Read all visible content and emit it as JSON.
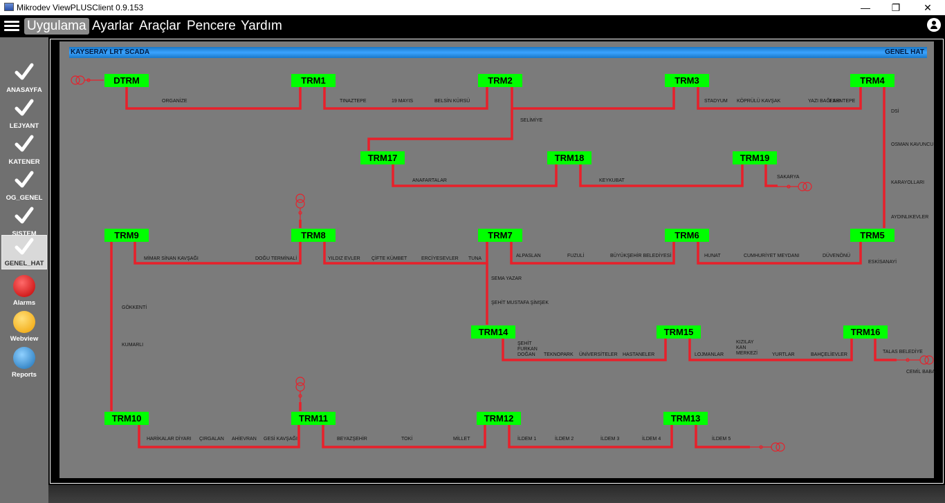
{
  "window": {
    "title": "Mikrodev ViewPLUSClient 0.9.153",
    "minimize": "—",
    "restore": "❐",
    "close": "✕"
  },
  "menu": [
    "Uygulama",
    "Ayarlar",
    "Araçlar",
    "Pencere",
    "Yardım"
  ],
  "sidebar": [
    {
      "label": "ANASAYFA",
      "icon": "check-icon"
    },
    {
      "label": "LEJYANT",
      "icon": "check-icon"
    },
    {
      "label": "KATENER",
      "icon": "check-icon"
    },
    {
      "label": "OG_GENEL",
      "icon": "check-icon"
    },
    {
      "label": "SISTEM",
      "icon": "check-icon"
    },
    {
      "label": "GENEL_HAT",
      "icon": "check-icon",
      "active": true
    },
    {
      "label": "Alarms",
      "icon": "alarm-icon"
    },
    {
      "label": "Webview",
      "icon": "cloud-icon"
    },
    {
      "label": "Reports",
      "icon": "reports-icon"
    }
  ],
  "header": {
    "left": "KAYSERAY LRT SCADA",
    "right": "GENEL HAT"
  },
  "colors": {
    "station": "#00ff00",
    "line": "#e8202a",
    "canvas": "#7b7b7b",
    "header": "#2e90ea"
  },
  "stations": [
    "DTRM",
    "TRM1",
    "TRM2",
    "TRM3",
    "TRM4",
    "TRM17",
    "TRM18",
    "TRM19",
    "TRM9",
    "TRM8",
    "TRM7",
    "TRM6",
    "TRM5",
    "TRM14",
    "TRM15",
    "TRM16",
    "TRM10",
    "TRM11",
    "TRM12",
    "TRM13"
  ],
  "stops": [
    "ORGANİZE",
    "TINAZTEPE",
    "19 MAYIS",
    "BELSİN KÜRSÜ",
    "STADYUM",
    "KÖPRÜLÜ KAVŞAK",
    "YAZI BAĞLARI",
    "ESENTEPE",
    "SELİMİYE",
    "ANAFARTALAR",
    "KEYKUBAT",
    "SAKARYA",
    "DSİ",
    "OSMAN KAVUNCU",
    "KARAYOLLARI",
    "AYDINLIKEVLER",
    "MİMAR SİNAN KAVŞAĞI",
    "DOĞU TERMİNALİ",
    "YILDIZ EVLER",
    "ÇİFTE KÜMBET",
    "ERCİYESEVLER",
    "TUNA",
    "ALPASLAN",
    "FUZULİ",
    "BÜYÜKŞEHİR BELEDİYESİ",
    "HUNAT",
    "CUMHURİYET MEYDANI",
    "DÜVENÖNÜ",
    "ESKİSANAYİ",
    "SEMA YAZAR",
    "ŞEHİT MUSTAFA ŞİMŞEK",
    "GÖKKENTİ",
    "KUMARLI",
    "ŞEHİT FURKAN DOĞAN",
    "TEKNOPARK",
    "ÜNİVERSİTELER",
    "HASTANELER",
    "LOJMANLAR",
    "KIZILAY KAN MERKEZİ",
    "YURTLAR",
    "BAHÇELİEVLER",
    "TALAS BELEDİYE",
    "CEMİL BABA",
    "HARİKALAR DİYARI",
    "ÇIRGALAN",
    "AHİEVRAN",
    "GESİ KAVŞAĞI",
    "BEYAZŞEHİR",
    "TOKİ",
    "MİLLET",
    "İLDEM 1",
    "İLDEM 2",
    "İLDEM 3",
    "İLDEM 4",
    "İLDEM 5"
  ]
}
